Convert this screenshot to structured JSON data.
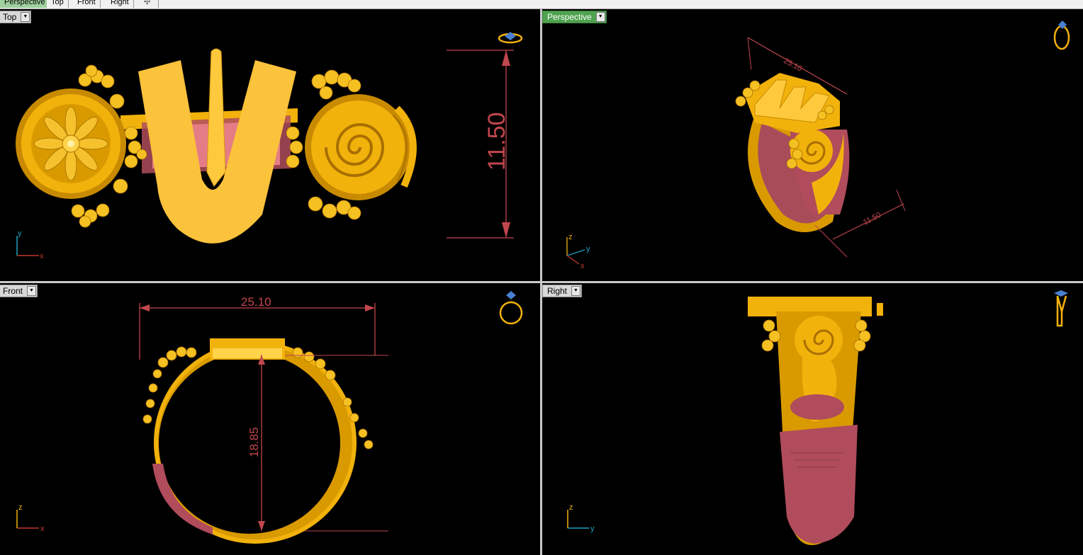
{
  "tabs": [
    {
      "label": "Perspective",
      "active": true
    },
    {
      "label": "Top",
      "active": false
    },
    {
      "label": "Front",
      "active": false
    },
    {
      "label": "Right",
      "active": false
    }
  ],
  "add_tab_icon": "plus-icon",
  "viewports": {
    "top": {
      "label": "Top",
      "dim_height": "11.50",
      "axis_x": "x",
      "axis_y": "y"
    },
    "perspective": {
      "label": "Perspective",
      "dim_width": "25.10",
      "dim_height": "11.50",
      "axis_x": "x",
      "axis_y": "y",
      "axis_z": "z"
    },
    "front": {
      "label": "Front",
      "dim_width": "25.10",
      "dim_height": "18.85",
      "axis_x": "x",
      "axis_z": "z"
    },
    "right": {
      "label": "Right",
      "axis_y": "y",
      "axis_z": "z"
    }
  },
  "colors": {
    "gold": "#f2b20c",
    "rose": "#b04c5c",
    "dimension": "#c0474e",
    "active_tab": "#9fd09f",
    "active_label": "#4fa24f"
  }
}
